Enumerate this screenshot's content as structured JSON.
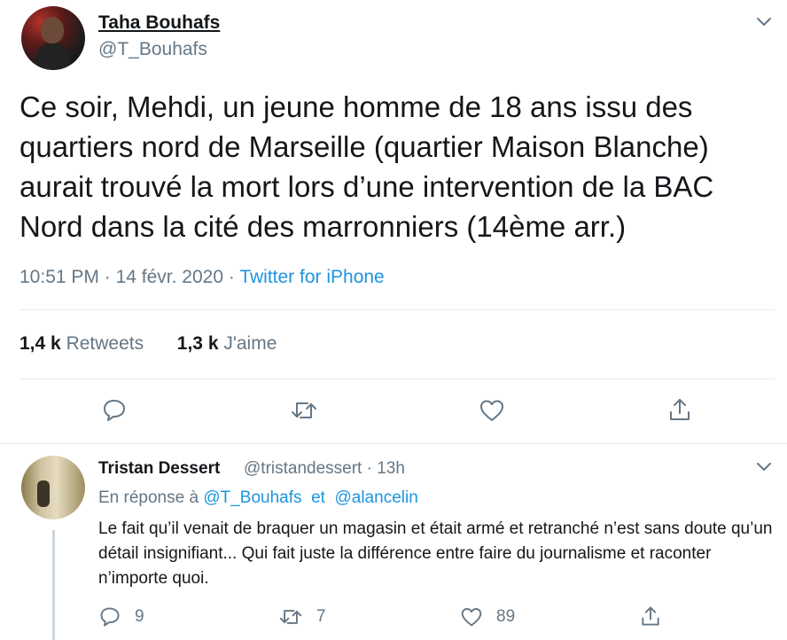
{
  "tweet": {
    "author_name": "Taha Bouhafs",
    "author_handle": "@T_Bouhafs",
    "text": "Ce soir, Mehdi, un jeune homme de 18 ans issu des quartiers nord de Marseille (quartier Maison Blanche) aurait trouvé la mort lors d’une intervention de la BAC Nord dans la cité des marronniers (14ème arr.)",
    "time": "10:51 PM",
    "date": "14 févr. 2020",
    "source": "Twitter for iPhone",
    "separator": "·",
    "retweets_count": "1,4 k",
    "retweets_label": "Retweets",
    "likes_count": "1,3 k",
    "likes_label": "J'aime"
  },
  "reply": {
    "author_name": "Tristan Dessert",
    "author_handle": "@tristandessert",
    "separator": "·",
    "age": "13h",
    "in_reply_prefix": "En réponse à",
    "in_reply_user1": "@T_Bouhafs",
    "in_reply_and": "et",
    "in_reply_user2": "@alancelin",
    "text": "Le fait qu’il venait de braquer un magasin et était armé et retranché n’est sans doute qu’un détail insignifiant... Qui fait juste la différence entre faire du journalisme et raconter n’importe quoi.",
    "reply_count": "9",
    "retweet_count": "7",
    "like_count": "89"
  },
  "icons": {
    "reply": "speech-bubble-icon",
    "retweet": "retweet-icon",
    "like": "heart-icon",
    "share": "share-icon",
    "more": "chevron-down-icon"
  },
  "colors": {
    "text": "#14171a",
    "secondary": "#657786",
    "link": "#1b95e0",
    "divider": "#e6ecf0"
  }
}
